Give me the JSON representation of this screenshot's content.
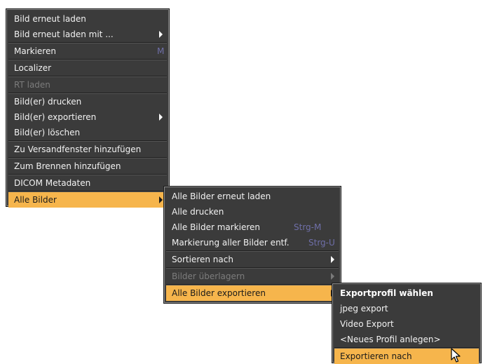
{
  "menu_main": {
    "items": [
      {
        "label": "Bild erneut laden"
      },
      {
        "label": "Bild erneut laden mit ..."
      },
      {
        "label": "Markieren",
        "shortcut": "M"
      },
      {
        "label": "Localizer"
      },
      {
        "label": "RT laden"
      },
      {
        "label": "Bild(er) drucken"
      },
      {
        "label": "Bild(er) exportieren"
      },
      {
        "label": "Bild(er) löschen"
      },
      {
        "label": "Zu Versandfenster hinzufügen"
      },
      {
        "label": "Zum Brennen hinzufügen"
      },
      {
        "label": "DICOM Metadaten"
      },
      {
        "label": "Alle Bilder"
      }
    ]
  },
  "menu_all_images": {
    "items": [
      {
        "label": "Alle Bilder erneut laden"
      },
      {
        "label": "Alle drucken"
      },
      {
        "label": "Alle Bilder markieren",
        "shortcut": "Strg-M"
      },
      {
        "label": "Markierung aller Bilder entf.",
        "shortcut": "Strg-U"
      },
      {
        "label": "Sortieren nach"
      },
      {
        "label": "Bilder überlagern"
      },
      {
        "label": "Alle Bilder exportieren"
      }
    ]
  },
  "menu_export_profile": {
    "header": "Exportprofil wählen",
    "items": [
      {
        "label": "jpeg export"
      },
      {
        "label": "Video Export"
      },
      {
        "label": "<Neues Profil anlegen>"
      },
      {
        "label": "Exportieren nach"
      }
    ]
  },
  "colors": {
    "menu_bg": "#3b3b3b",
    "highlight": "#f6b54c",
    "text": "#f2f2f2",
    "disabled_text": "#7c7c7c",
    "shortcut_text": "#6f6fa8"
  }
}
